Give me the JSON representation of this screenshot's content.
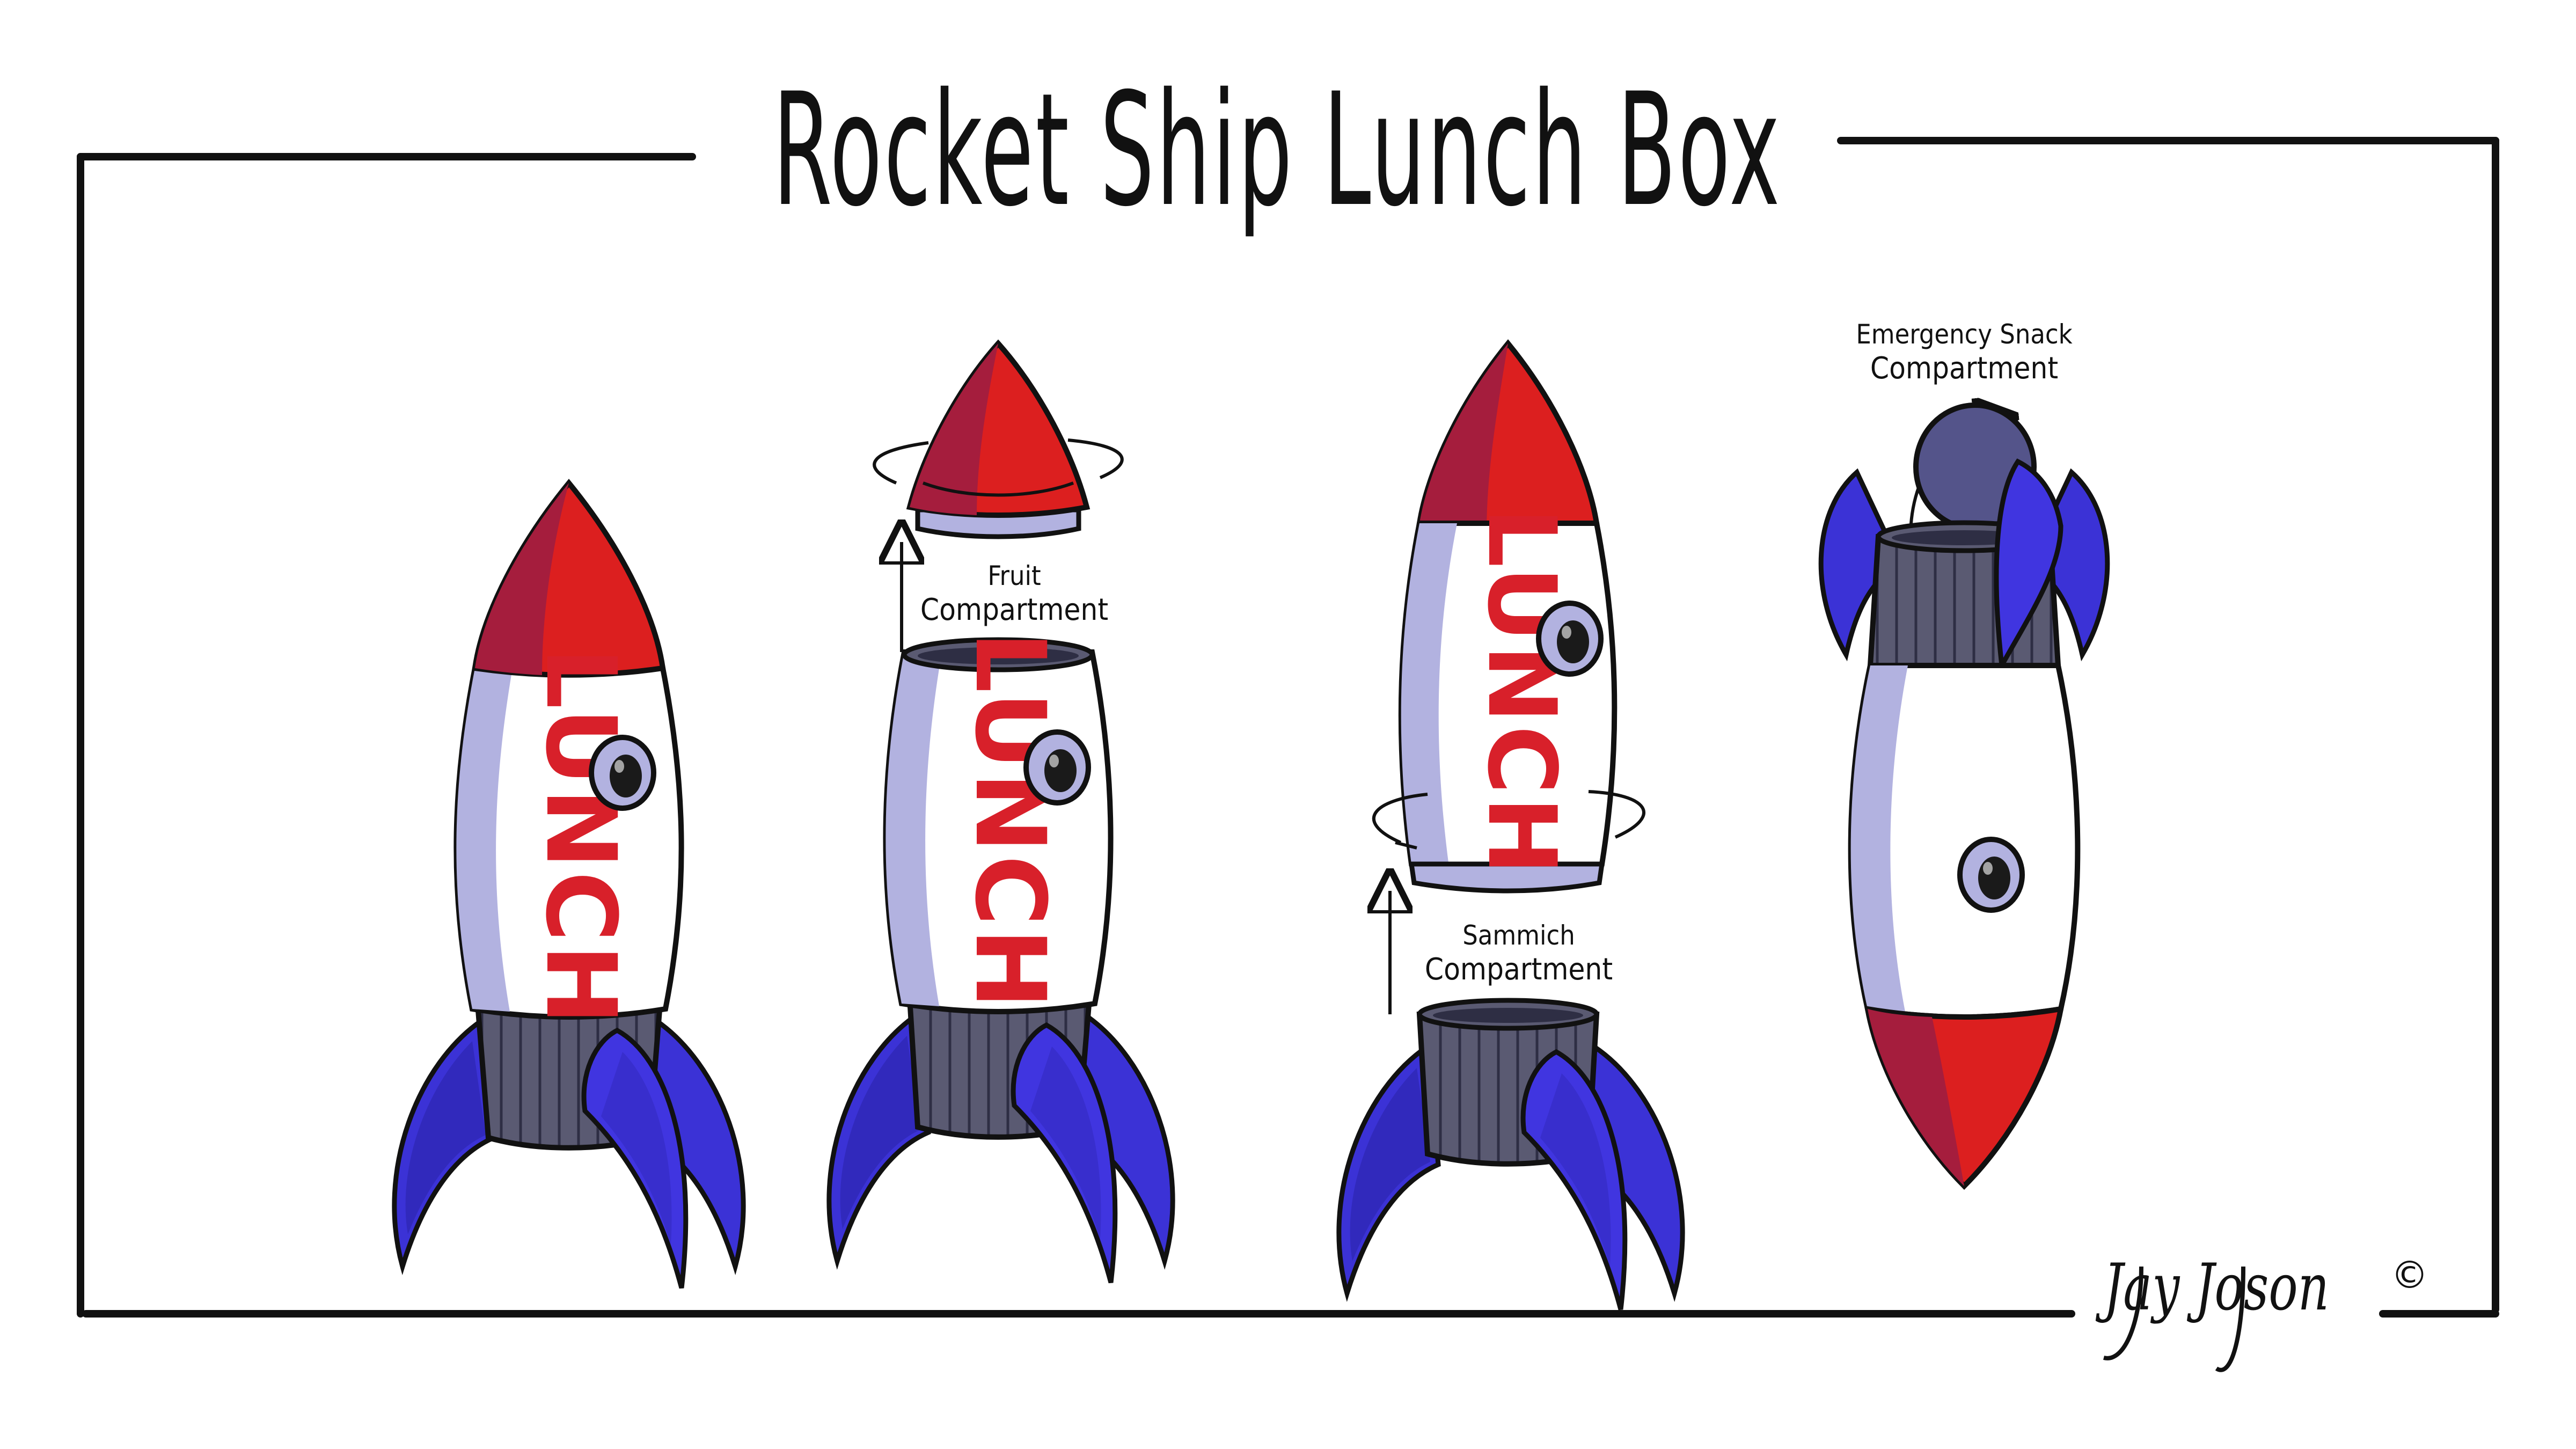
{
  "title": "Rocket Ship Lunch Box",
  "rocket_word": "LUNCH",
  "labels": {
    "fruit_line1": "Fruit",
    "fruit_line2": "Compartment",
    "sammich_line1": "Sammich",
    "sammich_line2": "Compartment",
    "snack_line1": "Emergency Snack",
    "snack_line2": "Compartment"
  },
  "signature": "Jay Joson",
  "copyright_symbol": "©",
  "colors": {
    "nose_red": "#dc1f1f",
    "nose_dark": "#a51d3d",
    "body_white": "#ffffff",
    "body_shade": "#b2b2e0",
    "base_gray": "#5a5a72",
    "fin_blue": "#3b32d6",
    "fin_dark": "#2a23a8",
    "lettering": "#d8202a",
    "outline": "#111111",
    "cap_purple": "#54548a"
  }
}
